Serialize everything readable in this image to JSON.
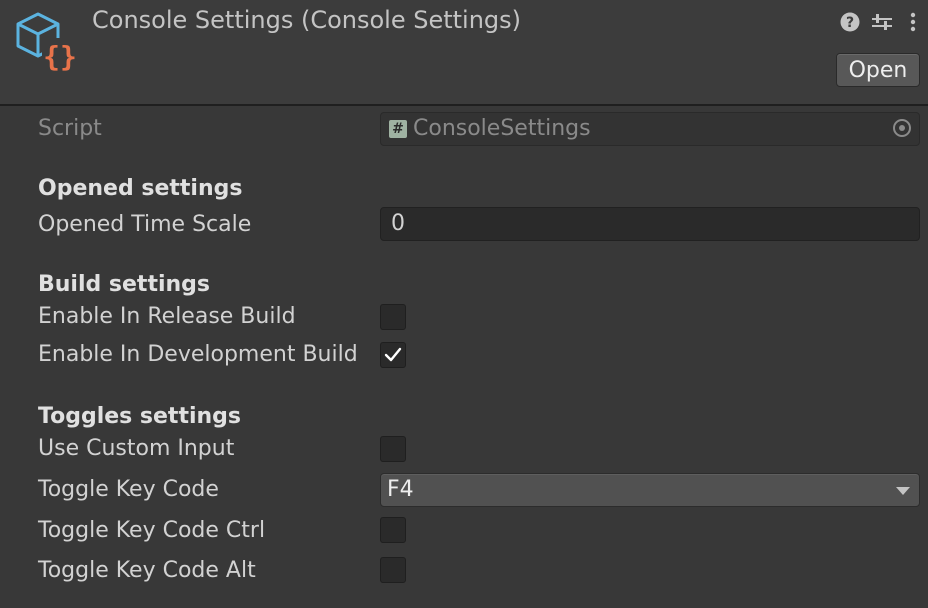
{
  "header": {
    "title": "Console Settings (Console Settings)",
    "open_label": "Open",
    "icons": [
      "scriptable-object-icon",
      "help-icon",
      "preset-sliders-icon",
      "kebab-menu-icon"
    ]
  },
  "script": {
    "label": "Script",
    "value": "ConsoleSettings",
    "hash": "#"
  },
  "sections": {
    "opened": "Opened settings",
    "build": "Build settings",
    "toggles": "Toggles settings"
  },
  "fields": {
    "opened_time_scale": {
      "label": "Opened Time Scale",
      "value": "0"
    },
    "enable_release": {
      "label": "Enable In Release Build",
      "checked": false
    },
    "enable_development": {
      "label": "Enable In Development Build",
      "checked": true
    },
    "use_custom_input": {
      "label": "Use Custom Input",
      "checked": false
    },
    "toggle_key_code": {
      "label": "Toggle Key Code",
      "value": "F4"
    },
    "toggle_key_code_ctrl": {
      "label": "Toggle Key Code Ctrl",
      "checked": false
    },
    "toggle_key_code_alt": {
      "label": "Toggle Key Code Alt",
      "checked": false
    }
  },
  "colors": {
    "background": "#383838",
    "header": "#3c3c3c",
    "field": "#2a2a2a",
    "accent_orange": "#e8734a",
    "icon_blue": "#5bb3e0"
  }
}
